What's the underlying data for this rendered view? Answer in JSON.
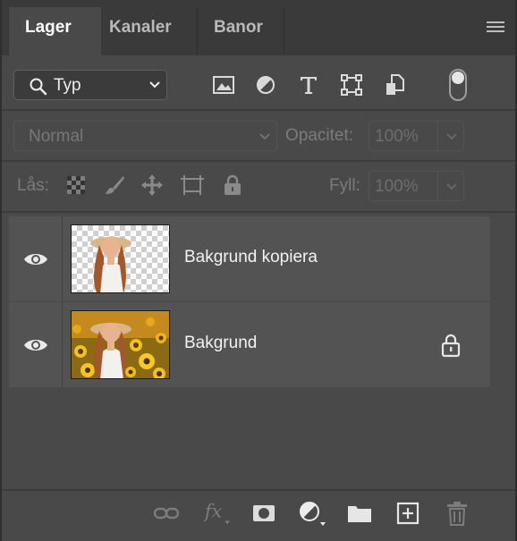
{
  "tabs": [
    {
      "label": "Lager",
      "active": true
    },
    {
      "label": "Kanaler",
      "active": false
    },
    {
      "label": "Banor",
      "active": false
    }
  ],
  "filter": {
    "selected": "Typ",
    "icons": [
      "image-filter-icon",
      "adjustment-filter-icon",
      "type-filter-icon",
      "shape-filter-icon",
      "smart-object-filter-icon"
    ]
  },
  "blend": {
    "mode": "Normal",
    "opacity_label": "Opacitet:",
    "opacity_value": "100%"
  },
  "lock": {
    "label": "Lås:",
    "fill_label": "Fyll:",
    "fill_value": "100%",
    "icons": [
      "lock-transparent-pixels-icon",
      "lock-image-pixels-icon",
      "lock-position-icon",
      "lock-artboard-icon",
      "lock-all-icon"
    ]
  },
  "layers": [
    {
      "name": "Bakgrund kopiera",
      "visible": true,
      "locked": false,
      "thumb": "cutout"
    },
    {
      "name": "Bakgrund",
      "visible": true,
      "locked": true,
      "thumb": "full"
    }
  ],
  "bottom_icons": [
    "link-layers-icon",
    "fx-icon",
    "add-mask-icon",
    "adjustment-layer-icon",
    "group-folder-icon",
    "new-layer-icon",
    "delete-layer-icon"
  ],
  "colors": {
    "panel_bg": "#494949",
    "tabbar_bg": "#3a3a3a",
    "row_bg": "#535353",
    "text": "#f2f2f2"
  }
}
